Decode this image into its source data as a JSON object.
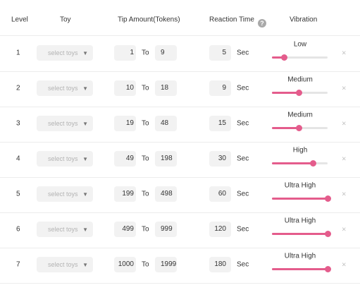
{
  "header": {
    "level": "Level",
    "toy": "Toy",
    "tip_amount": "Tip Amount(Tokens)",
    "reaction_time": "Reaction Time",
    "help": "?",
    "vibration": "Vibration"
  },
  "labels": {
    "to": "To",
    "sec": "Sec",
    "toy_placeholder": "select toys",
    "caret": "▼",
    "delete": "×"
  },
  "rows": [
    {
      "level": "1",
      "from": "1",
      "to": "9",
      "time": "5",
      "vibration": "Low",
      "level_fraction": 0.22
    },
    {
      "level": "2",
      "from": "10",
      "to": "18",
      "time": "9",
      "vibration": "Medium",
      "level_fraction": 0.48
    },
    {
      "level": "3",
      "from": "19",
      "to": "48",
      "time": "15",
      "vibration": "Medium",
      "level_fraction": 0.48
    },
    {
      "level": "4",
      "from": "49",
      "to": "198",
      "time": "30",
      "vibration": "High",
      "level_fraction": 0.74
    },
    {
      "level": "5",
      "from": "199",
      "to": "498",
      "time": "60",
      "vibration": "Ultra High",
      "level_fraction": 1.0
    },
    {
      "level": "6",
      "from": "499",
      "to": "999",
      "time": "120",
      "vibration": "Ultra High",
      "level_fraction": 1.0
    },
    {
      "level": "7",
      "from": "1000",
      "to": "1999",
      "time": "180",
      "vibration": "Ultra High",
      "level_fraction": 1.0
    }
  ],
  "colors": {
    "accent": "#e45c8c",
    "track": "#e5e5e5",
    "input_bg": "#f2f2f2"
  }
}
